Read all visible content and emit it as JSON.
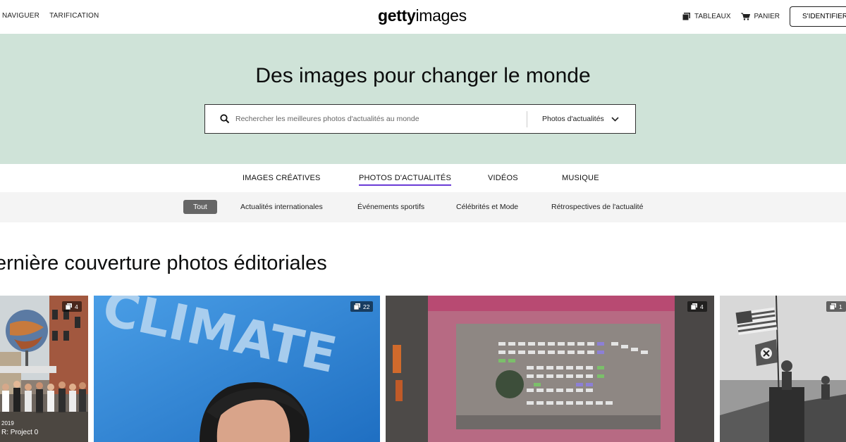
{
  "header": {
    "nav_left": [
      "NAVIGUER",
      "TARIFICATION"
    ],
    "logo_bold": "getty",
    "logo_light": "images",
    "boards": "TABLEAUX",
    "cart": "PANIER",
    "signin": "S'IDENTIFIER"
  },
  "hero": {
    "title": "Des images pour changer le monde",
    "search_placeholder": "Rechercher les meilleures photos d'actualités au monde",
    "dropdown_value": "Photos d'actualités",
    "bg_color": "#cfe3d8"
  },
  "tabs": [
    "IMAGES CRÉATIVES",
    "PHOTOS D'ACTUALITÉS",
    "VIDÉOS",
    "MUSIQUE"
  ],
  "active_tab": "PHOTOS D'ACTUALITÉS",
  "filters": [
    "Tout",
    "Actualités internationales",
    "Événements sportifs",
    "Célébrités et Mode",
    "Rétrospectives de l'actualité"
  ],
  "section": {
    "title": "ernière couverture photos éditoriales"
  },
  "tiles": [
    {
      "count": "4",
      "caption_date": "2019",
      "caption_title": "R: Project 0"
    },
    {
      "count": "22",
      "image_text": "CLIMATE"
    },
    {
      "count": "4"
    },
    {
      "count": "1"
    }
  ],
  "colors": {
    "accent": "#6a3bd6"
  }
}
